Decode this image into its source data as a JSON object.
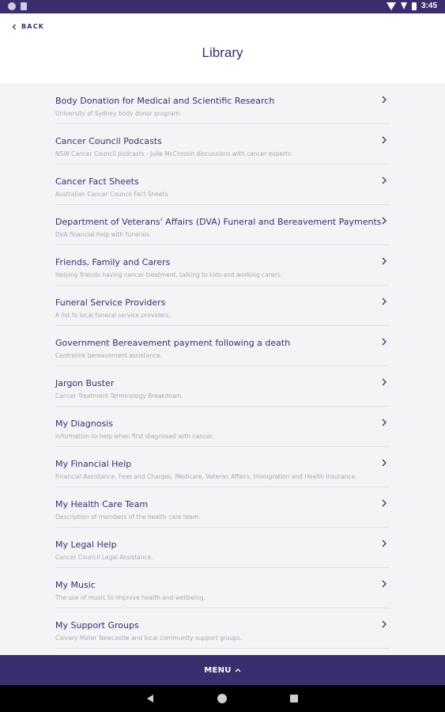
{
  "status_bar": {
    "time": "3:45"
  },
  "header": {
    "back_label": "BACK",
    "title": "Library"
  },
  "items": [
    {
      "title": "Body Donation for Medical and Scientific Research",
      "subtitle": "University of Sydney body donor program."
    },
    {
      "title": "Cancer Council Podcasts",
      "subtitle": "NSW Cancer Council podcasts - Julie McCrossin discussions with cancer experts."
    },
    {
      "title": "Cancer Fact Sheets",
      "subtitle": "Australian Cancer Council Fact Sheets"
    },
    {
      "title": "Department of Veterans' Affairs (DVA) Funeral and Bereavement Payments",
      "subtitle": "DVA financial help with funerals."
    },
    {
      "title": "Friends, Family and Carers",
      "subtitle": "Helping friends having cancer treatment, talking to kids and working carers."
    },
    {
      "title": "Funeral Service Providers",
      "subtitle": "A list fo local funeral service providers."
    },
    {
      "title": "Government Bereavement payment following a death",
      "subtitle": "Centrelink bereavement assistance."
    },
    {
      "title": "Jargon Buster",
      "subtitle": "Cancer Treatment Terminology Breakdown."
    },
    {
      "title": "My Diagnosis",
      "subtitle": "Information to help when first diagnosed with cancer."
    },
    {
      "title": "My Financial Help",
      "subtitle": "Financial Assistance, Fees and Charges, Medicare, Veteran Affairs, Immigration and Health Insurance."
    },
    {
      "title": "My Health Care Team",
      "subtitle": "Description of members of the health care team."
    },
    {
      "title": "My Legal Help",
      "subtitle": "Cancer Council Legal Assistance."
    },
    {
      "title": "My Music",
      "subtitle": "The use of music to improve health and wellbeing."
    },
    {
      "title": "My Support Groups",
      "subtitle": "Calvary Mater Newcastle and local community support groups."
    }
  ],
  "menu": {
    "label": "MENU"
  },
  "colors": {
    "brand": "#3a2e6e",
    "subtitle": "#a8a8b4",
    "background": "#f4f4f7"
  },
  "icons": {
    "back": "chevron-left-icon",
    "row": "chevron-right-icon",
    "menu": "chevron-up-icon"
  }
}
